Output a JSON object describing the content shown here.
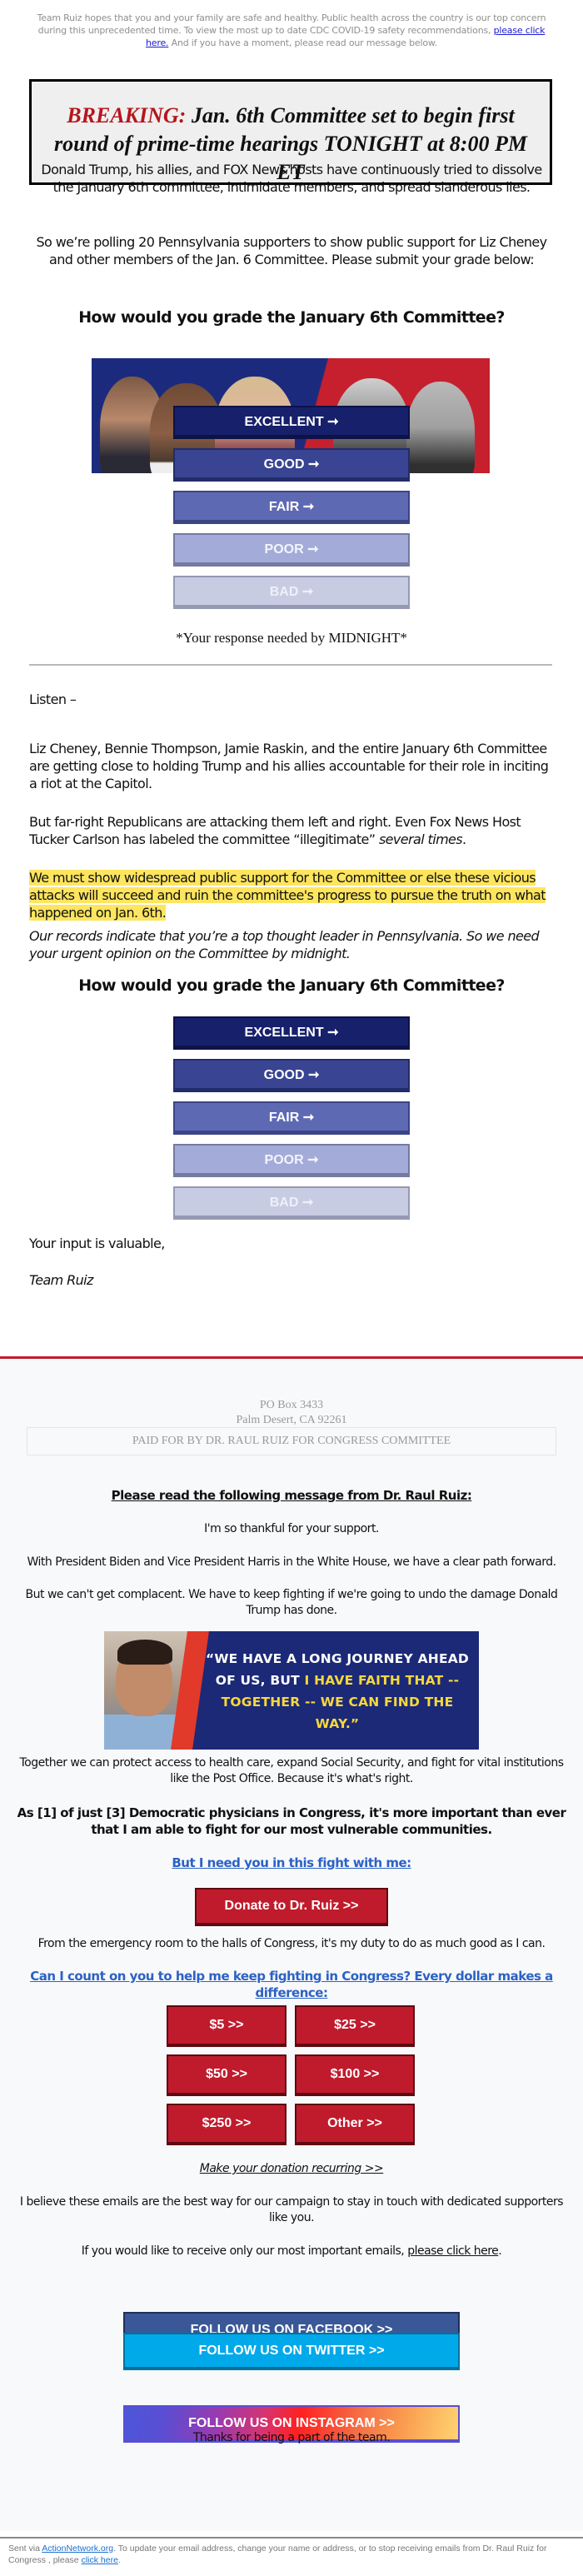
{
  "preheader": {
    "text_before": "Team Ruiz hopes that you and your family are safe and healthy. Public health across the country is our top concern during this unprecedented time. To view the most up to date CDC COVID-19 safety recommendations, ",
    "link": "please click here.",
    "text_after": " And if you have a moment, please read our message below."
  },
  "breaking": {
    "label": "BREAKING:",
    "headline": " Jan. 6th Committee set to begin first round of prime-time hearings TONIGHT at 8:00 PM ET"
  },
  "intro": {
    "p1": "Donald Trump, his allies, and FOX News hosts have continuously tried to dissolve the January 6th committee, intimidate members, and spread slanderous lies.",
    "p2": "So we’re polling 20 Pennsylvania supporters to show public support for Liz Cheney and other members of the Jan. 6 Committee. Please submit your grade below:"
  },
  "poll": {
    "question": "How would you grade the January 6th Committee?",
    "banner_alt": "Photo banner: Jan. 6 Committee members vs. Trump and McCarthy",
    "options": [
      {
        "label": "EXCELLENT ➞"
      },
      {
        "label": "GOOD ➞"
      },
      {
        "label": "FAIR ➞"
      },
      {
        "label": "POOR ➞"
      },
      {
        "label": "BAD ➞"
      }
    ],
    "deadline": "*Your response needed by MIDNIGHT*"
  },
  "body": {
    "listen": "Listen –",
    "p1": "Liz Cheney, Bennie Thompson, Jamie Raskin, and the entire January 6th Committee are getting close to holding Trump and his allies accountable for their role in inciting a riot at the Capitol.",
    "p2_before": "But far-right Republicans are attacking them left and right. Even Fox News Host Tucker Carlson has labeled the committee “illegitimate” ",
    "p2_italic": "several times",
    "p2_after": ".",
    "highlight": "We must show widespread public support for the Committee or else these vicious attacks will succeed and ruin the committee's progress to pursue the truth on what happened on Jan. 6th.",
    "italic_note": "Our records indicate that you’re a top thought leader in Pennsylvania. So we need your urgent opinion on the Committee by midnight.",
    "signoff": "Your input is valuable,",
    "signature": "Team Ruiz"
  },
  "footer": {
    "address_line1": "PO Box 3433",
    "address_line2": "Palm Desert, CA 92261",
    "paid_for": "PAID FOR BY DR. RAUL RUIZ FOR CONGRESS COMMITTEE",
    "heading": "Please read the following message from Dr. Raul Ruiz:",
    "p1": "I'm so thankful for your support.",
    "p2": "With President Biden and Vice President Harris in the White House, we have a clear path forward.",
    "p3": "But we can't get complacent. We have to keep fighting if we're going to undo the damage Donald Trump has done.",
    "quote": {
      "white": "“WE HAVE A LONG JOURNEY AHEAD OF US, BUT ",
      "yellow": "I HAVE FAITH THAT -- TOGETHER -- WE CAN FIND THE WAY.”"
    },
    "p4": "Together we can protect access to health care, expand Social Security, and fight for vital institutions like the Post Office. Because it's what's right.",
    "p5": "As [1] of just [3] Democratic physicians in Congress, it's more important than ever that I am able to fight for our most vulnerable communities.",
    "link1": "But I need you in this fight with me:",
    "donate_button": "Donate to Dr. Ruiz >>",
    "p6": "From the emergency room to the halls of Congress, it's my duty to do as much good as I can.",
    "link2": "Can I count on you to help me keep fighting in Congress? Every dollar makes a difference:",
    "amounts": [
      "$5 >>",
      "$25 >>",
      "$50 >>",
      "$100 >>",
      "$250 >>",
      "Other >>"
    ],
    "recurring": "Make your donation recurring >>",
    "p7": "I believe these emails are the best way for our campaign to stay in touch with dedicated supporters like you.",
    "p8_before": "If you would like to receive only our most important emails, ",
    "p8_link": "please click here",
    "p8_after": ".",
    "social": {
      "facebook": "FOLLOW US ON FACEBOOK >>",
      "twitter": "FOLLOW US ON TWITTER >>",
      "instagram": "FOLLOW US ON INSTAGRAM >>"
    },
    "thanks": "Thanks for being a part of the team."
  },
  "unsubscribe": {
    "before": "Sent via ",
    "link1": "ActionNetwork.org",
    "middle": ". To update your email address, change your name or address, or to stop receiving emails from Dr. Raul Ruiz for Congress , please ",
    "link2": "click here",
    "after": "."
  },
  "colors": {
    "breaking_red": "#b5161d",
    "excellent": "#17206b",
    "good": "#394592",
    "fair": "#5e69b4",
    "poor": "#a3acd9",
    "bad": "#c8cce2",
    "highlight": "#fde55e",
    "donate_red": "#c01b2c",
    "facebook": "#3a5897",
    "twitter": "#00a9e9",
    "link_blue": "#2c62c4"
  }
}
